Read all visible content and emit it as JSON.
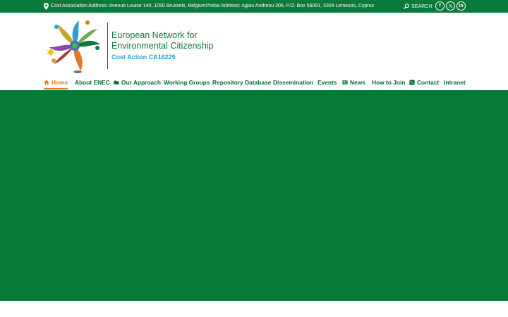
{
  "topbar": {
    "address_cost": "Cost Association Address: Avenue Louise 149, 1050 Brussels, Belgium",
    "address_postal": "Postal Address: Agiou Andreou 306, P.O. Box 56091, 3304 Lemesos, Cyprus",
    "search_label": "SEARCH",
    "social": [
      {
        "name": "facebook",
        "glyph": "f"
      },
      {
        "name": "x",
        "glyph": "𝕏"
      },
      {
        "name": "linkedin",
        "glyph": "in"
      }
    ]
  },
  "logo": {
    "title_line1": "European Network for",
    "title_line2": "Environmental Citizenship",
    "subtitle": "Cost Action CA16229"
  },
  "nav": {
    "items": [
      {
        "label": "Home",
        "icon": "home-icon",
        "active": true
      },
      {
        "label": "About ENEC"
      },
      {
        "label": "Our Approach",
        "icon": "folder-icon"
      },
      {
        "label": "Working Groups"
      },
      {
        "label": "Repository Database"
      },
      {
        "label": "Dissemination"
      },
      {
        "label": "Events"
      },
      {
        "label": "News",
        "icon": "newspaper-icon"
      },
      {
        "label": "How to Join"
      },
      {
        "label": "Contact",
        "icon": "phone-icon"
      },
      {
        "label": "Intranet"
      }
    ]
  },
  "colors": {
    "brand_green": "#0a7a3a",
    "hero_green": "#077a38",
    "accent_orange": "#e07a2b",
    "accent_blue": "#2e9fd0"
  }
}
